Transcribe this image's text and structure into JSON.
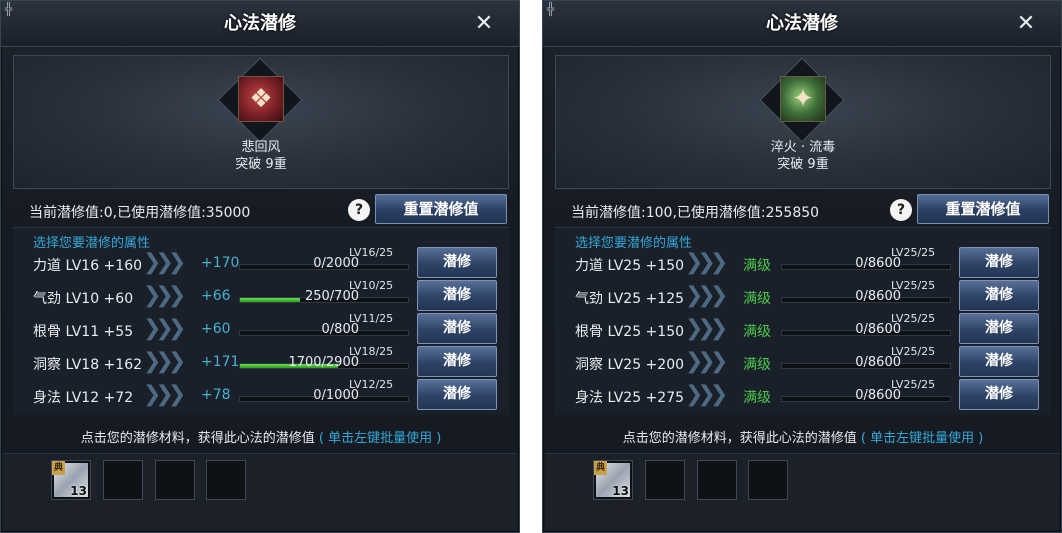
{
  "panels": [
    {
      "title": "心法潜修",
      "skill": {
        "name": "悲回风",
        "break": "突破 9重",
        "icon": "red-book-icon"
      },
      "status": "当前潜修值:0,已使用潜修值:35000",
      "reset_label": "重置潜修值",
      "attr_hint": "选择您要潜修的属性",
      "attributes": [
        {
          "label": "力道 LV16 +160",
          "gain": "+170",
          "lv": "LV16/25",
          "progress": "0/2000",
          "fill_pct": 0
        },
        {
          "label": "气劲 LV10 +60",
          "gain": "+66",
          "lv": "LV10/25",
          "progress": "250/700",
          "fill_pct": 35.7
        },
        {
          "label": "根骨 LV11 +55",
          "gain": "+60",
          "lv": "LV11/25",
          "progress": "0/800",
          "fill_pct": 0
        },
        {
          "label": "洞察 LV18 +162",
          "gain": "+171",
          "lv": "LV18/25",
          "progress": "1700/2900",
          "fill_pct": 58.6
        },
        {
          "label": "身法 LV12 +72",
          "gain": "+78",
          "lv": "LV12/25",
          "progress": "0/1000",
          "fill_pct": 0
        }
      ],
      "train_label": "潜修",
      "material_hint": "点击您的潜修材料，获得此心法的潜修值",
      "material_hint_link": "( 单击左键批量使用 )",
      "item_count": "13",
      "item_tag": "典"
    },
    {
      "title": "心法潜修",
      "skill": {
        "name": "淬火 · 流毒",
        "break": "突破 9重",
        "icon": "green-scroll-icon"
      },
      "status": "当前潜修值:100,已使用潜修值:255850",
      "reset_label": "重置潜修值",
      "attr_hint": "选择您要潜修的属性",
      "attributes": [
        {
          "label": "力道 LV25 +150",
          "gain": "满级",
          "lv": "LV25/25",
          "progress": "0/8600",
          "fill_pct": 0
        },
        {
          "label": "气劲 LV25 +125",
          "gain": "满级",
          "lv": "LV25/25",
          "progress": "0/8600",
          "fill_pct": 0
        },
        {
          "label": "根骨 LV25 +150",
          "gain": "满级",
          "lv": "LV25/25",
          "progress": "0/8600",
          "fill_pct": 0
        },
        {
          "label": "洞察 LV25 +200",
          "gain": "满级",
          "lv": "LV25/25",
          "progress": "0/8600",
          "fill_pct": 0
        },
        {
          "label": "身法 LV25 +275",
          "gain": "满级",
          "lv": "LV25/25",
          "progress": "0/8600",
          "fill_pct": 0
        }
      ],
      "train_label": "潜修",
      "material_hint": "点击您的潜修材料，获得此心法的潜修值",
      "material_hint_link": "( 单击左键批量使用 )",
      "item_count": "13",
      "item_tag": "典"
    }
  ]
}
